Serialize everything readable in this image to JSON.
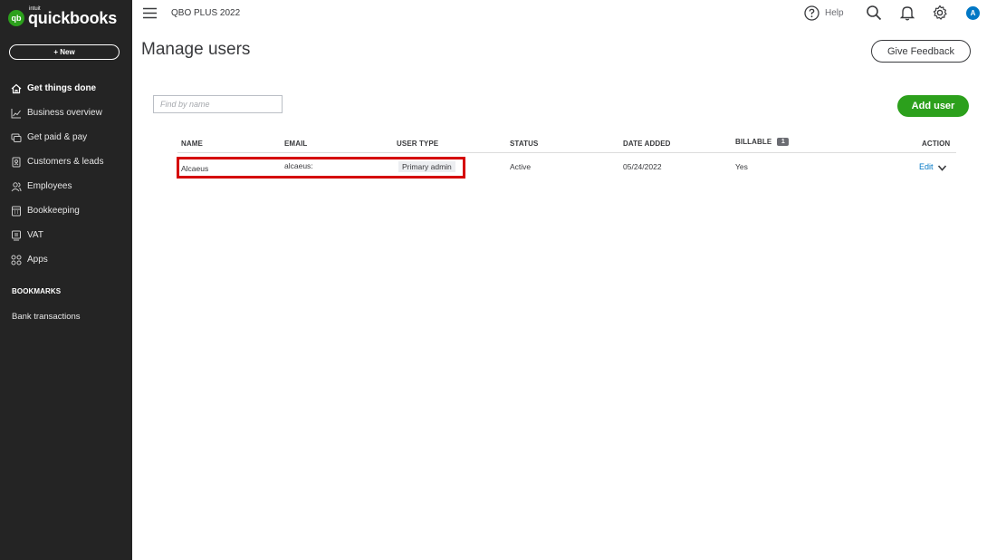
{
  "brand": {
    "small": "intuit",
    "name": "quickbooks",
    "mark": "qb"
  },
  "sidebar": {
    "new_label": "+ New",
    "items": [
      {
        "label": "Get things done",
        "icon": "home-icon",
        "active": true
      },
      {
        "label": "Business overview",
        "icon": "chart-line-icon",
        "active": false
      },
      {
        "label": "Get paid & pay",
        "icon": "payments-icon",
        "active": false
      },
      {
        "label": "Customers & leads",
        "icon": "contacts-icon",
        "active": false
      },
      {
        "label": "Employees",
        "icon": "people-icon",
        "active": false
      },
      {
        "label": "Bookkeeping",
        "icon": "ledger-icon",
        "active": false
      },
      {
        "label": "VAT",
        "icon": "vat-icon",
        "active": false
      },
      {
        "label": "Apps",
        "icon": "apps-grid-icon",
        "active": false
      }
    ],
    "bookmarks_title": "BOOKMARKS",
    "bookmarks": [
      "Bank transactions"
    ]
  },
  "topbar": {
    "company": "QBO PLUS 2022",
    "help_label": "Help",
    "avatar_initial": "A"
  },
  "page": {
    "title": "Manage users",
    "feedback_label": "Give Feedback",
    "find_placeholder": "Find by name",
    "add_user_label": "Add user"
  },
  "table": {
    "headers": {
      "name": "NAME",
      "email": "EMAIL",
      "user_type": "USER TYPE",
      "status": "STATUS",
      "date_added": "DATE ADDED",
      "billable": "BILLABLE",
      "billable_badge": "1",
      "action": "ACTION"
    },
    "rows": [
      {
        "name": "Alcaeus",
        "email": "alcaeus:",
        "user_type": "Primary admin",
        "status": "Active",
        "date_added": "05/24/2022",
        "billable": "Yes",
        "action": "Edit"
      }
    ]
  },
  "colors": {
    "sidebar_bg": "#242424",
    "accent_green": "#2ca01c",
    "link_blue": "#0077c5",
    "highlight_red": "#d50000"
  }
}
